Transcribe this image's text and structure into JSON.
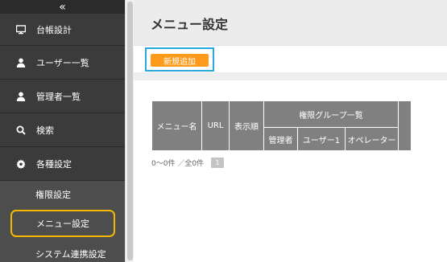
{
  "sidebar": {
    "collapse_symbol": "«",
    "items": [
      {
        "label": "台帳設計",
        "icon": "monitor-icon"
      },
      {
        "label": "ユーザー一覧",
        "icon": "user-icon"
      },
      {
        "label": "管理者一覧",
        "icon": "user-icon"
      },
      {
        "label": "検索",
        "icon": "search-icon"
      },
      {
        "label": "各種設定",
        "icon": "gear-icon"
      }
    ],
    "sub_items": [
      {
        "label": "権限設定"
      },
      {
        "label": "メニュー設定",
        "active": true
      },
      {
        "label": "システム連携設定"
      }
    ]
  },
  "page": {
    "title": "メニュー設定",
    "add_button": "新規追加"
  },
  "table": {
    "headers": [
      "メニュー名",
      "URL",
      "表示順"
    ],
    "group_header": "権限グループ一覧",
    "sub_headers": [
      "管理者",
      "ユーザー1",
      "オペレーター"
    ]
  },
  "pager": {
    "summary": "0〜0件 ／全0件",
    "current_page": "1"
  },
  "colors": {
    "sidebar_bg": "#3b3b3b",
    "active_highlight": "#f5b700",
    "add_button": "#ff9a1b",
    "button_frame": "#2aa7df",
    "table_header": "#808080"
  }
}
